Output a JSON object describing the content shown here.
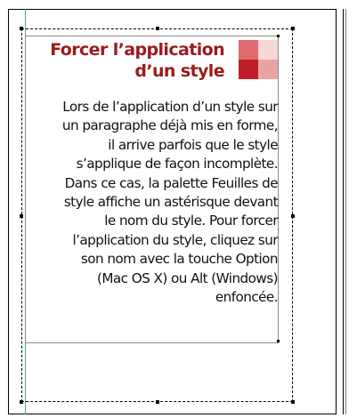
{
  "sidebar": {
    "title": "Forcer l’application\nd’un style",
    "body": "Lors de l’application d’un style sur\nun paragraphe déjà mis en forme,\nil arrive parfois que le style\ns’applique de façon incomplète.\nDans ce cas, la palette Feuilles de\nstyle affiche un astérisque devant\nle nom du style. Pour forcer\nl’application du style, cliquez sur\nson nom avec la touche Option\n(Mac OS X) ou Alt (Windows)\nenfoncée."
  },
  "colors": {
    "title": "#9b1b1b",
    "swatch": [
      "#e06b6f",
      "#f6d7d5",
      "#bf1d27",
      "#e9a3a3"
    ]
  }
}
